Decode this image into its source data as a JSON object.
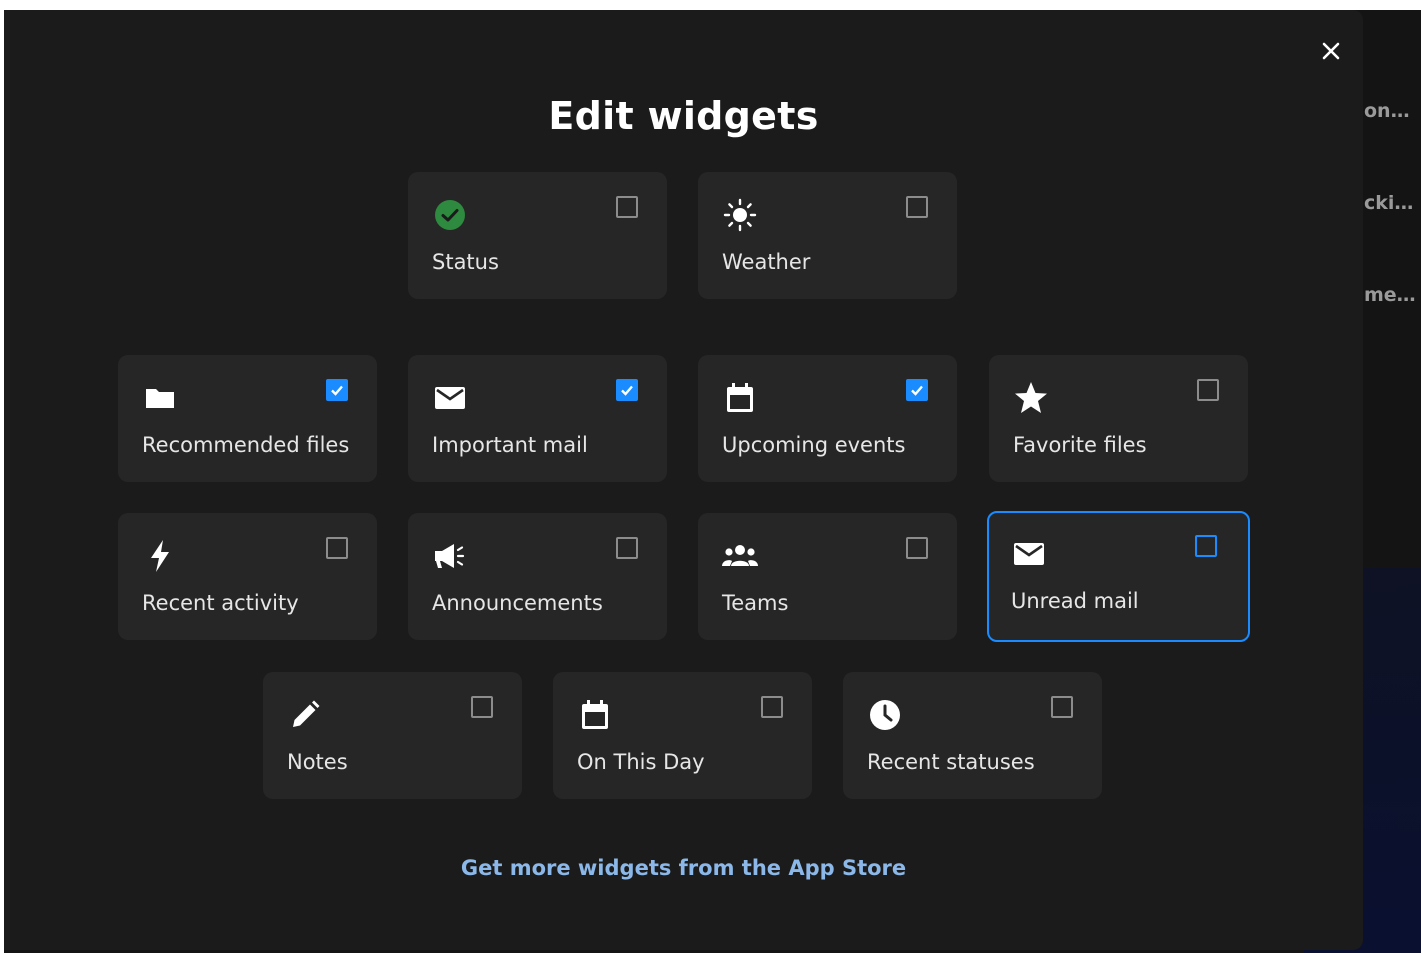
{
  "background": {
    "snippets": [
      "on…",
      "cki…",
      "me…"
    ]
  },
  "dialog": {
    "title": "Edit widgets",
    "close_icon": "close-icon",
    "footer_link": "Get more widgets from the App Store",
    "accent_color": "#1a8cff",
    "link_color": "#8bb8e8"
  },
  "widgets": [
    {
      "label": "Status",
      "icon": "status-check-icon",
      "checked": false
    },
    {
      "label": "Weather",
      "icon": "sun-icon",
      "checked": false
    },
    {
      "label": "Recommended files",
      "icon": "folder-icon",
      "checked": true
    },
    {
      "label": "Important mail",
      "icon": "mail-icon",
      "checked": true
    },
    {
      "label": "Upcoming events",
      "icon": "calendar-icon",
      "checked": true
    },
    {
      "label": "Favorite files",
      "icon": "star-icon",
      "checked": false
    },
    {
      "label": "Recent activity",
      "icon": "lightning-icon",
      "checked": false
    },
    {
      "label": "Announcements",
      "icon": "megaphone-icon",
      "checked": false
    },
    {
      "label": "Teams",
      "icon": "people-icon",
      "checked": false
    },
    {
      "label": "Unread mail",
      "icon": "mail-icon",
      "checked": false,
      "focused": true
    },
    {
      "label": "Notes",
      "icon": "pencil-icon",
      "checked": false
    },
    {
      "label": "On This Day",
      "icon": "calendar-icon",
      "checked": false
    },
    {
      "label": "Recent statuses",
      "icon": "clock-icon",
      "checked": false
    }
  ]
}
